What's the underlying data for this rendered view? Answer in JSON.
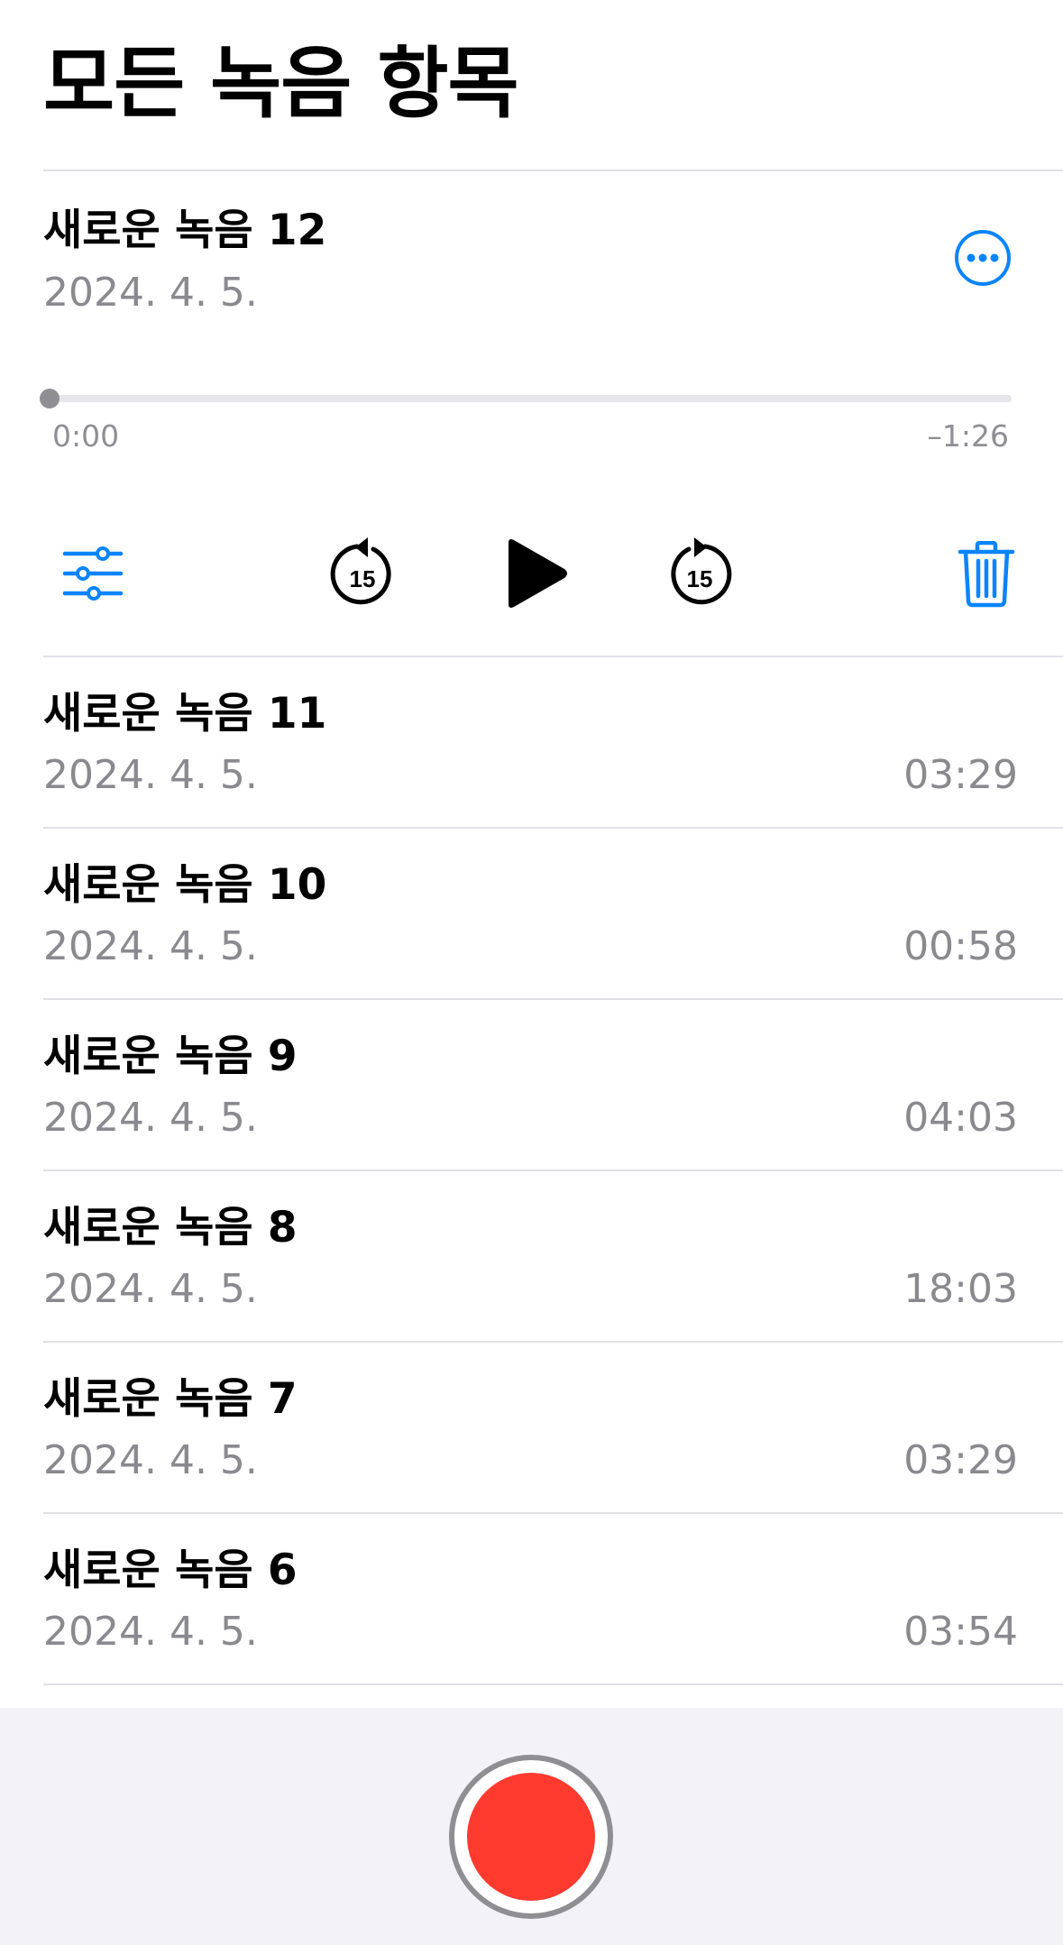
{
  "page": {
    "title": "모든 녹음 항목"
  },
  "expanded_recording": {
    "title": "새로운 녹음 12",
    "date": "2024. 4. 5.",
    "elapsed": "0:00",
    "remaining": "–1:26",
    "progress": 0
  },
  "recordings": [
    {
      "title": "새로운 녹음 11",
      "date": "2024. 4. 5.",
      "duration": "03:29"
    },
    {
      "title": "새로운 녹음 10",
      "date": "2024. 4. 5.",
      "duration": "00:58"
    },
    {
      "title": "새로운 녹음 9",
      "date": "2024. 4. 5.",
      "duration": "04:03"
    },
    {
      "title": "새로운 녹음 8",
      "date": "2024. 4. 5.",
      "duration": "18:03"
    },
    {
      "title": "새로운 녹음 7",
      "date": "2024. 4. 5.",
      "duration": "03:29"
    },
    {
      "title": "새로운 녹음 6",
      "date": "2024. 4. 5.",
      "duration": "03:54"
    }
  ],
  "controls": {
    "skip_back_seconds": "15",
    "skip_forward_seconds": "15",
    "icons": [
      "sliders-icon",
      "skip-back-15-icon",
      "play-icon",
      "skip-forward-15-icon",
      "trash-icon",
      "more-ellipsis-icon",
      "record-icon"
    ]
  },
  "colors": {
    "accent": "#0a84ff",
    "record": "#ff3b30",
    "secondary_text": "#8a8a8e",
    "record_bar_bg": "#f2f2f7"
  }
}
